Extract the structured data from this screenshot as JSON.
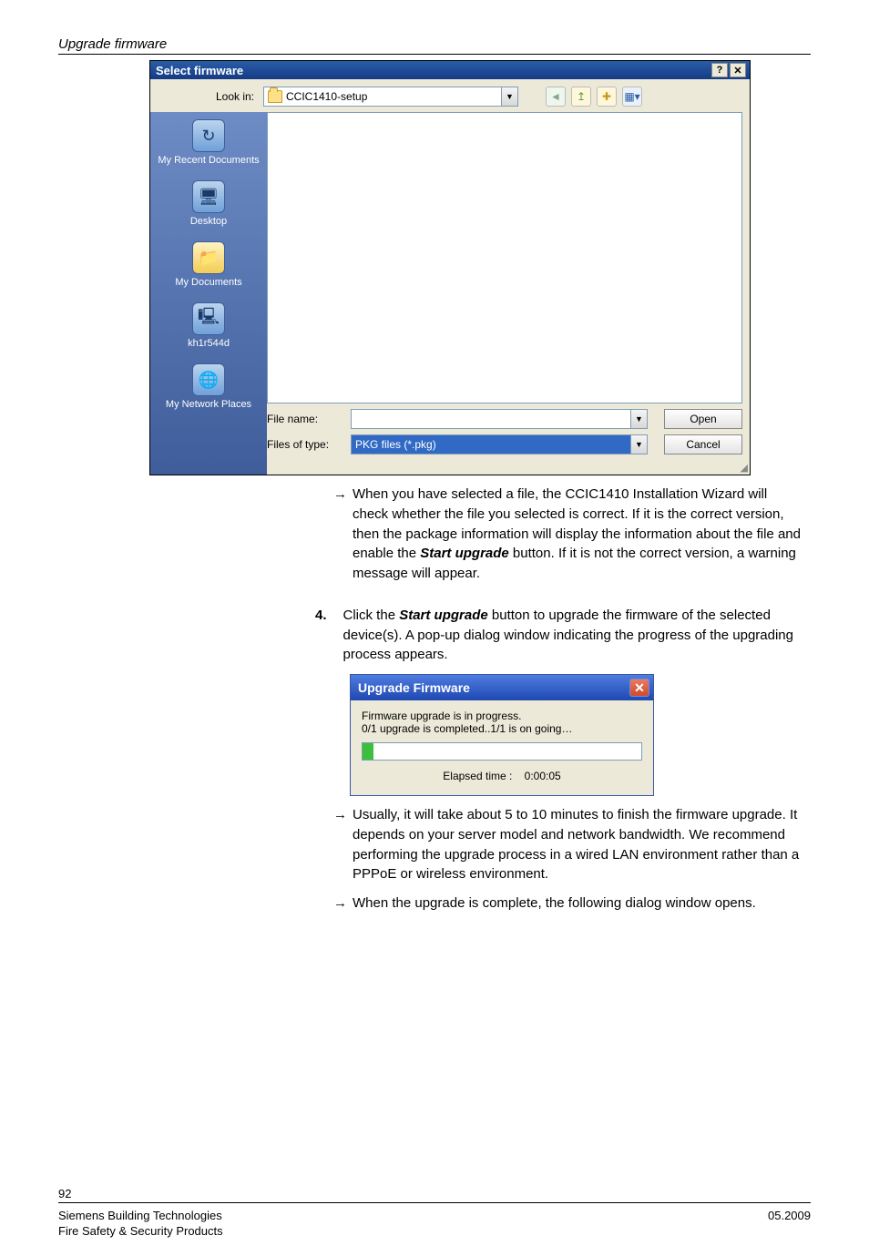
{
  "section_heading": "Upgrade firmware",
  "file_dialog": {
    "title": "Select firmware",
    "lookin_label": "Look in:",
    "lookin_value": "CCIC1410-setup",
    "sidebar": [
      {
        "label": "My Recent Documents",
        "icon": "↻"
      },
      {
        "label": "Desktop",
        "icon": "🖥"
      },
      {
        "label": "My Documents",
        "icon": "📁"
      },
      {
        "label": "kh1r544d",
        "icon": "🖳"
      },
      {
        "label": "My Network Places",
        "icon": "🌐"
      }
    ],
    "filename_label": "File name:",
    "filename_value": "",
    "filetype_label": "Files of type:",
    "filetype_value": "PKG files (*.pkg)",
    "open_label": "Open",
    "cancel_label": "Cancel"
  },
  "paragraphs": {
    "p1_prefix": "When you have selected a file, the CCIC1410 Installation Wizard will check whether the file you selected is correct. If it is the correct version, then the package information will display the information about the file and enable the ",
    "p1_bold": "Start upgrade",
    "p1_suffix": " button. If it is not the correct version, a warning message will appear.",
    "step4_num": "4.",
    "step4_prefix": "Click the ",
    "step4_bold": "Start upgrade",
    "step4_suffix": " button to upgrade the firmware of the selected device(s). A pop-up dialog window indicating the progress of the upgrading process appears.",
    "p3": "Usually, it will take about 5 to 10 minutes to finish the firmware upgrade. It depends on your server model and network bandwidth. We recommend performing the upgrade process in a wired LAN environment rather than a PPPoE or wireless environment.",
    "p4": "When the upgrade is complete, the following dialog window opens."
  },
  "progress_dialog": {
    "title": "Upgrade Firmware",
    "line1": "Firmware upgrade is in progress.",
    "line2": "0/1 upgrade is completed..1/1 is on going…",
    "elapsed_label": "Elapsed time :",
    "elapsed_value": "0:00:05"
  },
  "footer": {
    "page": "92",
    "line1": "Siemens Building Technologies",
    "line2": "Fire Safety & Security Products",
    "date": "05.2009"
  }
}
